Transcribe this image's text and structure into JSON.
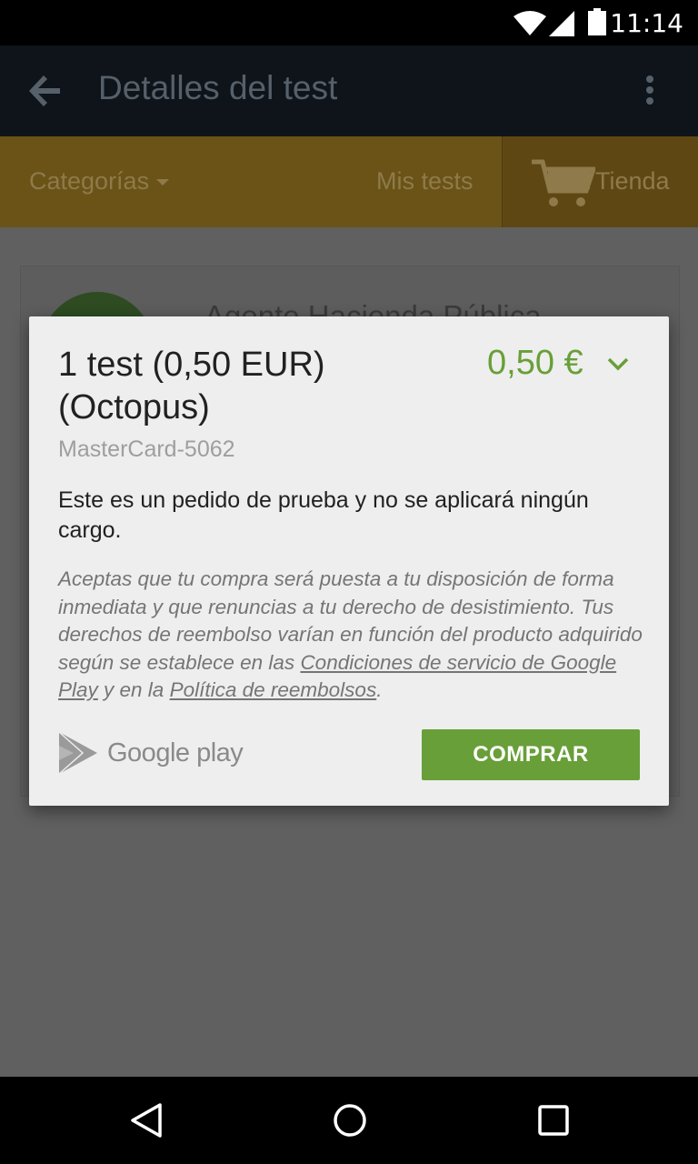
{
  "status_bar": {
    "time": "11:14"
  },
  "app_bar": {
    "title": "Detalles del test"
  },
  "tabs": {
    "categories": "Categorías",
    "my_tests": "Mis tests",
    "shop": "Tienda"
  },
  "background_card": {
    "title": "Agente Hacienda Pública"
  },
  "dialog": {
    "product": "1 test (0,50 EUR) (Octopus)",
    "price": "0,50 €",
    "payment_method": "MasterCard-5062",
    "notice": "Este es un pedido de prueba y no se aplicará ningún cargo.",
    "legal_part1": "Aceptas que tu compra será puesta a tu disposición de forma inmediata y que renuncias a tu derecho de desistimiento. Tus derechos de reembolso varían en función del producto adquirido según se establece en las ",
    "terms_link": "Condiciones de servicio de Google Play",
    "legal_part2": " y en la ",
    "refund_link": "Política de reembolsos",
    "legal_part3": ".",
    "brand": "Google play",
    "buy_label": "COMPRAR"
  },
  "colors": {
    "accent": "#689f38",
    "dim_overlay": "#606060"
  }
}
